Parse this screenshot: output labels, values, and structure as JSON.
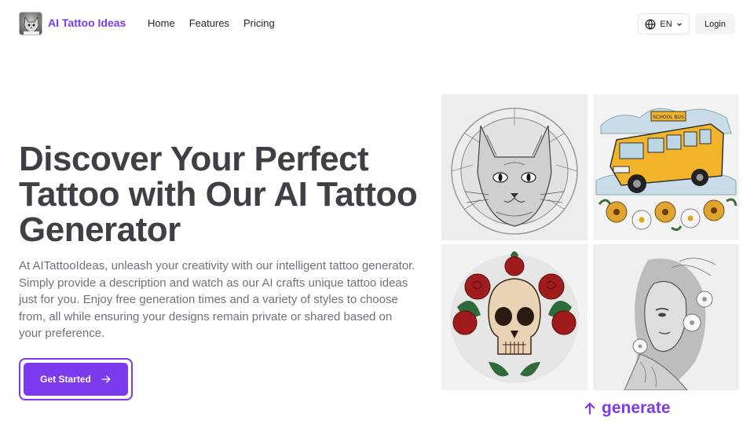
{
  "header": {
    "brand": "AI Tattoo Ideas",
    "nav": [
      "Home",
      "Features",
      "Pricing"
    ],
    "language": "EN",
    "login": "Login"
  },
  "hero": {
    "title": "Discover Your Perfect Tattoo with Our AI Tattoo Generator",
    "description": "At AITattooIdeas, unleash your creativity with our intelligent tattoo generator. Simply provide a description and watch as our AI crafts unique tattoo ideas just for you. Enjoy free generation times and a variety of styles to choose from, all while ensuring your designs remain private or shared based on your preference.",
    "cta": "Get Started"
  },
  "gallery": {
    "bus_sign": "SCHOOL BUS",
    "generate_label": "generate"
  },
  "colors": {
    "accent": "#7c3aed",
    "heading": "#3f3f46",
    "body_text": "#71717a"
  },
  "icons": [
    "logo-icon",
    "globe-icon",
    "chevron-down-icon",
    "arrow-right-icon",
    "arrow-up-icon"
  ]
}
